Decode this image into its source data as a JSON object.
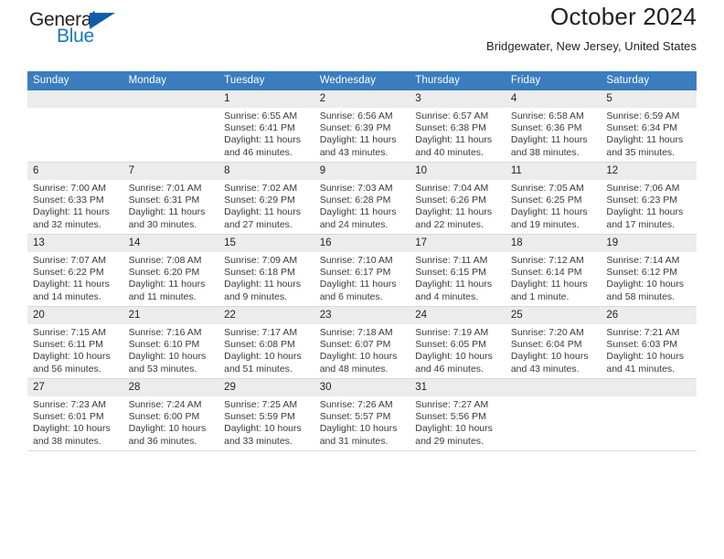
{
  "brand": {
    "word_one": "General",
    "word_two": "Blue",
    "triangle_color": "#0d5ea8",
    "blue_color": "#1878be"
  },
  "header": {
    "title": "October 2024",
    "subtitle": "Bridgewater, New Jersey, United States"
  },
  "theme": {
    "header_row_bg": "#3b7dbf",
    "daynum_bg": "#ececec",
    "row_border": "#d9d9d9"
  },
  "calendar": {
    "weekday_headers": [
      "Sunday",
      "Monday",
      "Tuesday",
      "Wednesday",
      "Thursday",
      "Friday",
      "Saturday"
    ],
    "weeks": [
      [
        {
          "day": "",
          "lines": []
        },
        {
          "day": "",
          "lines": []
        },
        {
          "day": "1",
          "lines": [
            "Sunrise: 6:55 AM",
            "Sunset: 6:41 PM",
            "Daylight: 11 hours",
            "and 46 minutes."
          ]
        },
        {
          "day": "2",
          "lines": [
            "Sunrise: 6:56 AM",
            "Sunset: 6:39 PM",
            "Daylight: 11 hours",
            "and 43 minutes."
          ]
        },
        {
          "day": "3",
          "lines": [
            "Sunrise: 6:57 AM",
            "Sunset: 6:38 PM",
            "Daylight: 11 hours",
            "and 40 minutes."
          ]
        },
        {
          "day": "4",
          "lines": [
            "Sunrise: 6:58 AM",
            "Sunset: 6:36 PM",
            "Daylight: 11 hours",
            "and 38 minutes."
          ]
        },
        {
          "day": "5",
          "lines": [
            "Sunrise: 6:59 AM",
            "Sunset: 6:34 PM",
            "Daylight: 11 hours",
            "and 35 minutes."
          ]
        }
      ],
      [
        {
          "day": "6",
          "lines": [
            "Sunrise: 7:00 AM",
            "Sunset: 6:33 PM",
            "Daylight: 11 hours",
            "and 32 minutes."
          ]
        },
        {
          "day": "7",
          "lines": [
            "Sunrise: 7:01 AM",
            "Sunset: 6:31 PM",
            "Daylight: 11 hours",
            "and 30 minutes."
          ]
        },
        {
          "day": "8",
          "lines": [
            "Sunrise: 7:02 AM",
            "Sunset: 6:29 PM",
            "Daylight: 11 hours",
            "and 27 minutes."
          ]
        },
        {
          "day": "9",
          "lines": [
            "Sunrise: 7:03 AM",
            "Sunset: 6:28 PM",
            "Daylight: 11 hours",
            "and 24 minutes."
          ]
        },
        {
          "day": "10",
          "lines": [
            "Sunrise: 7:04 AM",
            "Sunset: 6:26 PM",
            "Daylight: 11 hours",
            "and 22 minutes."
          ]
        },
        {
          "day": "11",
          "lines": [
            "Sunrise: 7:05 AM",
            "Sunset: 6:25 PM",
            "Daylight: 11 hours",
            "and 19 minutes."
          ]
        },
        {
          "day": "12",
          "lines": [
            "Sunrise: 7:06 AM",
            "Sunset: 6:23 PM",
            "Daylight: 11 hours",
            "and 17 minutes."
          ]
        }
      ],
      [
        {
          "day": "13",
          "lines": [
            "Sunrise: 7:07 AM",
            "Sunset: 6:22 PM",
            "Daylight: 11 hours",
            "and 14 minutes."
          ]
        },
        {
          "day": "14",
          "lines": [
            "Sunrise: 7:08 AM",
            "Sunset: 6:20 PM",
            "Daylight: 11 hours",
            "and 11 minutes."
          ]
        },
        {
          "day": "15",
          "lines": [
            "Sunrise: 7:09 AM",
            "Sunset: 6:18 PM",
            "Daylight: 11 hours",
            "and 9 minutes."
          ]
        },
        {
          "day": "16",
          "lines": [
            "Sunrise: 7:10 AM",
            "Sunset: 6:17 PM",
            "Daylight: 11 hours",
            "and 6 minutes."
          ]
        },
        {
          "day": "17",
          "lines": [
            "Sunrise: 7:11 AM",
            "Sunset: 6:15 PM",
            "Daylight: 11 hours",
            "and 4 minutes."
          ]
        },
        {
          "day": "18",
          "lines": [
            "Sunrise: 7:12 AM",
            "Sunset: 6:14 PM",
            "Daylight: 11 hours",
            "and 1 minute."
          ]
        },
        {
          "day": "19",
          "lines": [
            "Sunrise: 7:14 AM",
            "Sunset: 6:12 PM",
            "Daylight: 10 hours",
            "and 58 minutes."
          ]
        }
      ],
      [
        {
          "day": "20",
          "lines": [
            "Sunrise: 7:15 AM",
            "Sunset: 6:11 PM",
            "Daylight: 10 hours",
            "and 56 minutes."
          ]
        },
        {
          "day": "21",
          "lines": [
            "Sunrise: 7:16 AM",
            "Sunset: 6:10 PM",
            "Daylight: 10 hours",
            "and 53 minutes."
          ]
        },
        {
          "day": "22",
          "lines": [
            "Sunrise: 7:17 AM",
            "Sunset: 6:08 PM",
            "Daylight: 10 hours",
            "and 51 minutes."
          ]
        },
        {
          "day": "23",
          "lines": [
            "Sunrise: 7:18 AM",
            "Sunset: 6:07 PM",
            "Daylight: 10 hours",
            "and 48 minutes."
          ]
        },
        {
          "day": "24",
          "lines": [
            "Sunrise: 7:19 AM",
            "Sunset: 6:05 PM",
            "Daylight: 10 hours",
            "and 46 minutes."
          ]
        },
        {
          "day": "25",
          "lines": [
            "Sunrise: 7:20 AM",
            "Sunset: 6:04 PM",
            "Daylight: 10 hours",
            "and 43 minutes."
          ]
        },
        {
          "day": "26",
          "lines": [
            "Sunrise: 7:21 AM",
            "Sunset: 6:03 PM",
            "Daylight: 10 hours",
            "and 41 minutes."
          ]
        }
      ],
      [
        {
          "day": "27",
          "lines": [
            "Sunrise: 7:23 AM",
            "Sunset: 6:01 PM",
            "Daylight: 10 hours",
            "and 38 minutes."
          ]
        },
        {
          "day": "28",
          "lines": [
            "Sunrise: 7:24 AM",
            "Sunset: 6:00 PM",
            "Daylight: 10 hours",
            "and 36 minutes."
          ]
        },
        {
          "day": "29",
          "lines": [
            "Sunrise: 7:25 AM",
            "Sunset: 5:59 PM",
            "Daylight: 10 hours",
            "and 33 minutes."
          ]
        },
        {
          "day": "30",
          "lines": [
            "Sunrise: 7:26 AM",
            "Sunset: 5:57 PM",
            "Daylight: 10 hours",
            "and 31 minutes."
          ]
        },
        {
          "day": "31",
          "lines": [
            "Sunrise: 7:27 AM",
            "Sunset: 5:56 PM",
            "Daylight: 10 hours",
            "and 29 minutes."
          ]
        },
        {
          "day": "",
          "lines": []
        },
        {
          "day": "",
          "lines": []
        }
      ]
    ]
  }
}
